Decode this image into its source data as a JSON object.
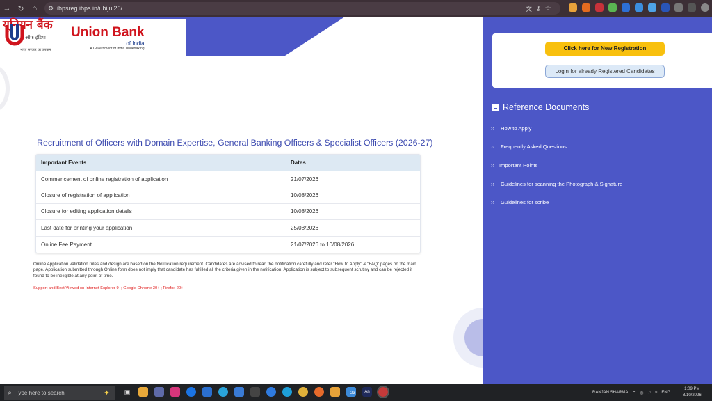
{
  "browser": {
    "url": "ibpsreg.ibps.in/ubijul26/",
    "nav_icons": [
      "back-icon",
      "forward-icon",
      "reload-icon",
      "home-icon"
    ]
  },
  "logo": {
    "hindi_name": "यूनियन बैंक",
    "hindi_sub": "ऑफ़ इंडिया",
    "hindi_tag": "भारत सरकार का उपक्रम",
    "english_name": "Union Bank",
    "english_sub": "of India",
    "english_tag": "A Government of India Undertaking"
  },
  "main": {
    "title": "Recruitment of Officers with Domain Expertise, General Banking Officers & Specialist Officers (2026-27)",
    "table": {
      "headers": [
        "Important Events",
        "Dates"
      ],
      "rows": [
        {
          "event": "Commencement of online registration of application",
          "date": "21/07/2026"
        },
        {
          "event": "Closure of registration of application",
          "date": "10/08/2026"
        },
        {
          "event": "Closure for editing application details",
          "date": "10/08/2026"
        },
        {
          "event": "Last date for printing your application",
          "date": "25/08/2026"
        },
        {
          "event": "Online Fee Payment",
          "date": "21/07/2026 to 10/08/2026"
        }
      ]
    },
    "notice": "Online Application validation rules and design are based on the Notification requirement. Candidates are advised to read the notification carefully and refer \"How to Apply\" & \"FAQ\" pages on the main page. Application submitted through Online form does not imply that candidate has fulfilled all the criteria given in the notification. Application is subject to subsequent scrutiny and can be rejected if found to be ineligible at any point of time.",
    "support": "Support and Best Viewed on Internet Explorer 9+; Google Chrome 30+ ; Firefox 20+"
  },
  "sidebar": {
    "new_registration_label": "Click here for New Registration",
    "login_label": "Login for already Registered Candidates",
    "reference_title": "Reference Documents",
    "reference_items": [
      "How to Apply",
      "Frequently Asked Questions",
      "Important Points",
      "Guidelines for scanning the Photograph & Signature",
      "Guidelines for scribe"
    ]
  },
  "taskbar": {
    "search_placeholder": "Type here to search",
    "user_name": "RANJAN SHARMA",
    "language": "ENG",
    "time": "1:09 PM",
    "date": "8/10/2026",
    "badge_count": "23"
  },
  "colors": {
    "brand_red": "#d0141d",
    "accent_blue": "#4c57c7",
    "title_blue": "#3d4bb0",
    "yellow_button": "#f8c00e",
    "support_red": "#e02020"
  }
}
